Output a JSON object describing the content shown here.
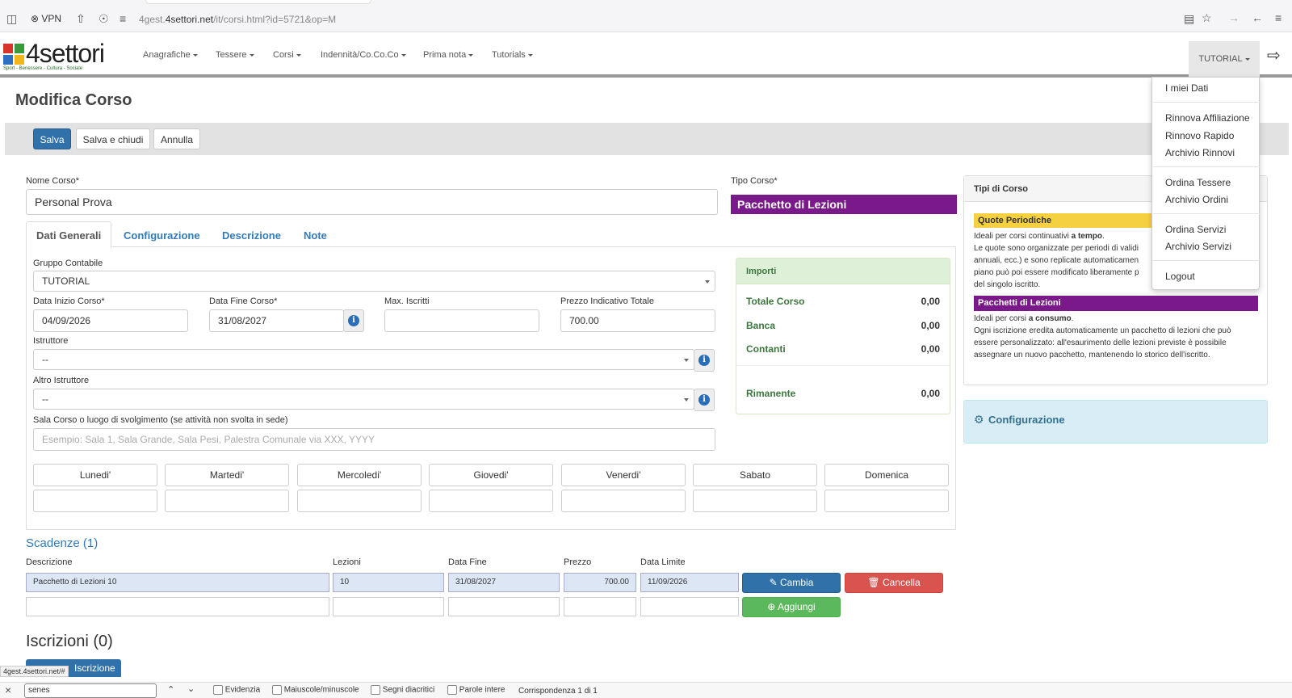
{
  "browser": {
    "vpn_label": "VPN",
    "url_prefix": "4gest.",
    "url_domain": "4settori.net",
    "url_path": "/it/corsi.html?id=5721&op=M"
  },
  "navbar": {
    "brand": "4settori",
    "brand_tagline": "Sport - Benessere - Cultura - Sociale",
    "menus": [
      "Anagrafiche",
      "Tessere",
      "Corsi",
      "Indennità/Co.Co.Co",
      "Prima nota",
      "Tutorials"
    ],
    "user_menu": "TUTORIAL"
  },
  "page": {
    "title": "Modifica Corso",
    "buttons": {
      "save": "Salva",
      "save_close": "Salva e chiudi",
      "cancel": "Annulla"
    }
  },
  "form": {
    "nome_label": "Nome Corso*",
    "nome_value": "Personal Prova",
    "tipo_label": "Tipo Corso*",
    "tipo_value": "Pacchetto di Lezioni",
    "tabs": [
      "Dati Generali",
      "Configurazione",
      "Descrizione",
      "Note"
    ],
    "gruppo_label": "Gruppo Contabile",
    "gruppo_value": "TUTORIAL",
    "data_inizio_label": "Data Inizio Corso*",
    "data_inizio_value": "04/09/2026",
    "data_fine_label": "Data Fine Corso*",
    "data_fine_value": "31/08/2027",
    "max_iscritti_label": "Max. Iscritti",
    "max_iscritti_value": "",
    "prezzo_label": "Prezzo Indicativo Totale",
    "prezzo_value": "700.00",
    "istruttore_label": "Istruttore",
    "istruttore_value": "--",
    "altro_istruttore_label": "Altro Istruttore",
    "altro_istruttore_value": "--",
    "sala_label": "Sala Corso o luogo di svolgimento (se attività non svolta in sede)",
    "sala_placeholder": "Esempio: Sala 1, Sala Grande, Sala Pesi, Palestra Comunale via XXX, YYYY",
    "days": [
      "Lunedi'",
      "Martedi'",
      "Mercoledi'",
      "Giovedi'",
      "Venerdi'",
      "Sabato",
      "Domenica"
    ]
  },
  "importi": {
    "title": "Importi",
    "rows": [
      {
        "label": "Totale Corso",
        "value": "0,00"
      },
      {
        "label": "Banca",
        "value": "0,00"
      },
      {
        "label": "Contanti",
        "value": "0,00"
      },
      {
        "label": "Rimanente",
        "value": "0,00"
      }
    ]
  },
  "tipi_corso": {
    "title": "Tipi di Corso",
    "quote_title": "Quote Periodiche",
    "quote_line1_pre": "Ideali per corsi continuativi ",
    "quote_line1_bold": "a tempo",
    "quote_line2": "Le quote sono organizzate per periodi di validi",
    "quote_line3": "annuali, ecc.) e sono replicate automaticamen",
    "quote_line4": "piano può poi essere modificato liberamente p",
    "quote_line5": "del singolo iscritto.",
    "pacchetti_title": "Pacchetti di Lezioni",
    "pacchetti_line1_pre": "Ideali per corsi ",
    "pacchetti_line1_bold": "a consumo",
    "pacchetti_line2": "Ogni iscrizione eredita automaticamente un pacchetto di lezioni che può",
    "pacchetti_line3": "essere personalizzato: all'esaurimento delle lezioni previste è possibile",
    "pacchetti_line4": "assegnare un nuovo pacchetto, mantenendo lo storico dell'iscritto."
  },
  "configurazione_panel": {
    "title": "Configurazione"
  },
  "scadenze": {
    "title": "Scadenze (1)",
    "headers": [
      "Descrizione",
      "Lezioni",
      "Data Fine",
      "Prezzo",
      "Data Limite"
    ],
    "row": {
      "descrizione": "Pacchetto di Lezioni 10",
      "lezioni": "10",
      "data_fine": "31/08/2027",
      "prezzo": "700.00",
      "data_limite": "11/09/2026"
    },
    "btn_cambia": "Cambia",
    "btn_cancella": "Cancella",
    "btn_aggiungi": "Aggiungi"
  },
  "iscrizioni": {
    "title": "Iscrizioni (0)",
    "button": "Iscrizione",
    "status_url": "4gest.4settori.net/#"
  },
  "dropdown": {
    "items": [
      "I miei Dati",
      "Rinnova Affiliazione",
      "Rinnovo Rapido",
      "Archivio Rinnovi",
      "Ordina Tessere",
      "Archivio Ordini",
      "Ordina Servizi",
      "Archivio Servizi",
      "Logout"
    ]
  },
  "findbar": {
    "query": "senes",
    "options": [
      "Evidenzia",
      "Maiuscole/minuscole",
      "Segni diacritici",
      "Parole intere"
    ],
    "result": "Corrispondenza 1 di 1"
  },
  "colors": {
    "primary": "#3071a9",
    "tipo_corso": "#7a1a8a",
    "danger": "#d9534f",
    "success": "#5cb85c",
    "importi_header": "#dff0d8",
    "quote_yellow": "#f5d142"
  }
}
